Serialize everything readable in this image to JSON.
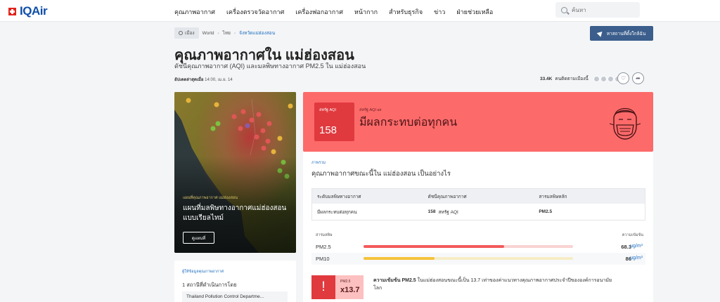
{
  "header": {
    "logo_text": "IQAir",
    "nav": [
      "คุณภาพอากาศ",
      "เครื่องตรวจวัดอากาศ",
      "เครื่องฟอกอากาศ",
      "หน้ากาก",
      "สำหรับธุรกิจ",
      "ข่าว",
      "ฝ่ายช่วยเหลือ"
    ],
    "search_placeholder": "ค้นหา"
  },
  "breadcrumb": {
    "city_chip": "เมือง",
    "items": [
      "World",
      "ไทย",
      "จังหวัดแม่ฮ่องสอน"
    ]
  },
  "nearest_button": "หาสถานที่ตั้งใกล้ฉัน",
  "page": {
    "title": "คุณภาพอากาศใน แม่ฮ่องสอน",
    "subtitle": "ดัชนีคุณภาพอากาศ (AQI) และมลพิษทางอากาศ PM2.5 ใน แม่ฮ่องสอน",
    "updated_label": "อัปเดตล่าสุดเมื่อ",
    "updated_time": "14:00, เม.ย. 14"
  },
  "followers": {
    "count": "33.4K",
    "label": "คนติดตามเมืองนี้"
  },
  "map_card": {
    "kicker": "แผนที่คุณภาพอากาศ แม่ฮ่องสอน",
    "title": "แผนที่มลพิษทางอากาศแม่ฮ่องสอนแบบเรียลไทม์",
    "button": "ดูแผนที่"
  },
  "contributors": {
    "kicker": "ผู้ให้ข้อมูลคุณภาพอากาศ",
    "count": "1 สถานีที่ดำเนินการโดย",
    "station": "Thailand Pollution Control Departme..."
  },
  "aqi": {
    "box_label": "สหรัฐ AQI",
    "value": "158",
    "kicker": "สหรัฐ AQI air",
    "status": "มีผลกระทบต่อทุกคน",
    "color": "#fd6a6a"
  },
  "overview": {
    "kicker": "ภาพรวม",
    "question": "คุณภาพอากาศขณะนี้ใน แม่ฮ่องสอน เป็นอย่างไร",
    "headers": [
      "ระดับมลพิษทางอากาศ",
      "ดัชนีคุณภาพอากาศ",
      "สารมลพิษหลัก"
    ],
    "row": {
      "level": "มีผลกระทบต่อทุกคน",
      "aqi_value": "158",
      "aqi_unit": "สหรัฐ AQI",
      "main": "PM2.5"
    }
  },
  "pollutants": {
    "label_left": "สารมลพิษ",
    "label_right": "ความเข้มข้น",
    "unit": "µg/m³",
    "items": [
      {
        "name": "PM2.5",
        "value": "68.3",
        "fraction": 0.67,
        "fill": "#f25a5a",
        "track": "#f9d3d3"
      },
      {
        "name": "PM10",
        "value": "86",
        "fraction": 0.34,
        "fill": "#f5c33b",
        "track": "#f6ecc6"
      }
    ]
  },
  "alert": {
    "icon": "!",
    "label": "PM2.5",
    "multiplier": "x13.7",
    "text_bold": "ความเข้มข้น PM2.5",
    "text_rest": "ในแม่ฮ่องสอนขณะนี้เป็น 13.7 เท่าของค่าแนวทางคุณภาพอากาศประจำปีขององค์การอนามัยโลก"
  }
}
